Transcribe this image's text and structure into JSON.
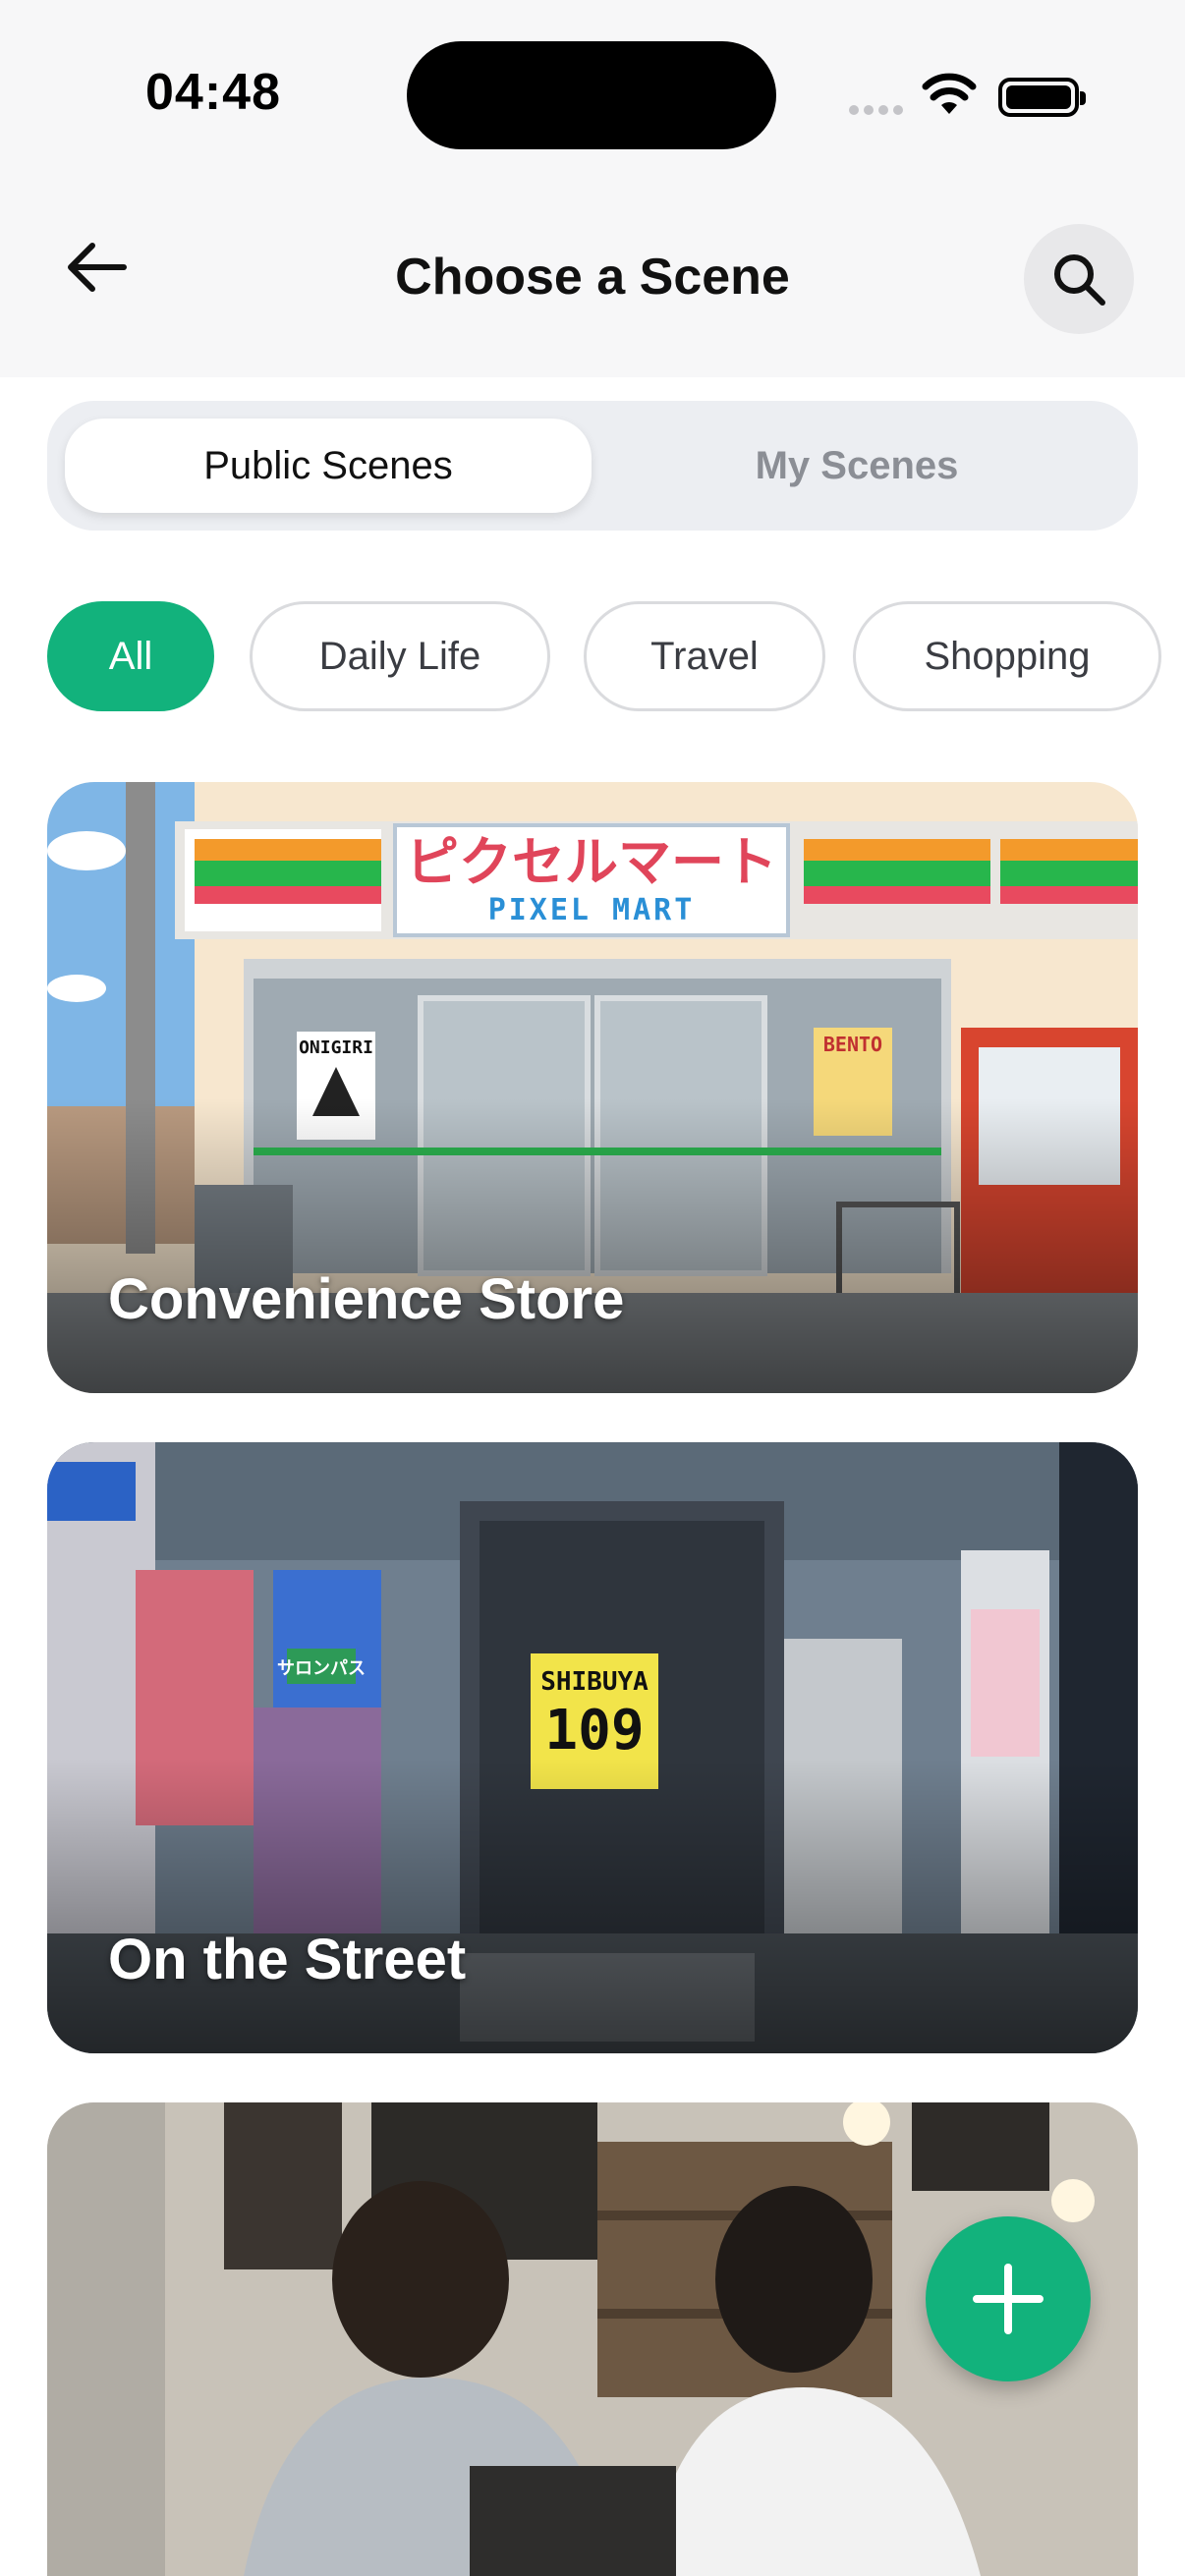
{
  "status_bar": {
    "time": "04:48"
  },
  "header": {
    "title": "Choose a Scene"
  },
  "tabs": [
    {
      "label": "Public Scenes",
      "active": true
    },
    {
      "label": "My Scenes",
      "active": false
    }
  ],
  "categories": [
    {
      "label": "All",
      "active": true
    },
    {
      "label": "Daily Life",
      "active": false
    },
    {
      "label": "Travel",
      "active": false
    },
    {
      "label": "Shopping",
      "active": false
    }
  ],
  "scenes": [
    {
      "title": "Convenience Store",
      "sign_jp": "ピクセルマート",
      "sign_en": "PIXEL MART",
      "poster_left": "ONIGIRI",
      "poster_right": "BENTO"
    },
    {
      "title": "On the Street",
      "building_sign": "SHIBUYA",
      "building_number": "109",
      "billboard": "サロンパス"
    },
    {
      "title": ""
    }
  ],
  "colors": {
    "accent": "#12b27c",
    "header_bg": "#f7f7f8",
    "segment_bg": "#eceef2"
  },
  "icons": {
    "back": "arrow-left-icon",
    "search": "search-icon",
    "add": "plus-icon"
  }
}
